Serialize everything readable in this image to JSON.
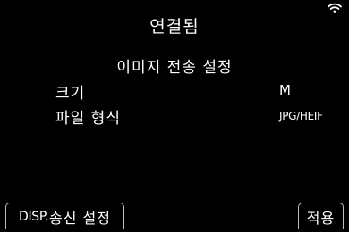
{
  "status": {
    "title": "연결됨",
    "wifi_icon": "wifi-icon"
  },
  "section": {
    "title": "이미지 전송 설정"
  },
  "settings": [
    {
      "label": "크기",
      "value": "M"
    },
    {
      "label": "파일 형식",
      "value": "JPG/HEIF"
    }
  ],
  "footer": {
    "disp_key": "DISP.",
    "disp_label": "송신 설정",
    "apply_label": "적용"
  }
}
